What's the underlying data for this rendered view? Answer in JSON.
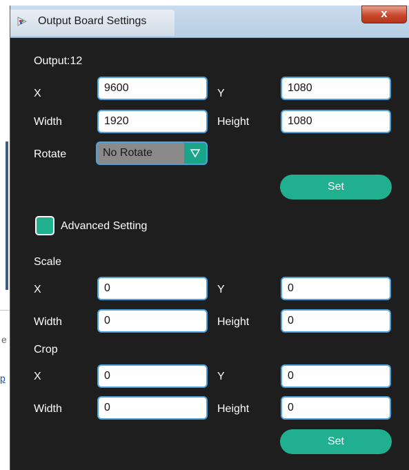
{
  "window": {
    "title": "Output Board Settings",
    "close_label": "x"
  },
  "background": {
    "glyph_e": "e",
    "glyph_p": "p"
  },
  "output_label": "Output:12",
  "position": {
    "x_label": "X",
    "x_value": "9600",
    "y_label": "Y",
    "y_value": "1080",
    "width_label": "Width",
    "width_value": "1920",
    "height_label": "Height",
    "height_value": "1080"
  },
  "rotate": {
    "label": "Rotate",
    "value": "No Rotate"
  },
  "set_label": "Set",
  "advanced": {
    "label": "Advanced Setting",
    "checked": true
  },
  "scale": {
    "title": "Scale",
    "x_label": "X",
    "x_value": "0",
    "y_label": "Y",
    "y_value": "0",
    "width_label": "Width",
    "width_value": "0",
    "height_label": "Height",
    "height_value": "0"
  },
  "crop": {
    "title": "Crop",
    "x_label": "X",
    "x_value": "0",
    "y_label": "Y",
    "y_value": "0",
    "width_label": "Width",
    "width_value": "0",
    "height_label": "Height",
    "height_value": "0"
  },
  "colors": {
    "accent": "#20b08f",
    "field_border": "#4aa3df",
    "panel_bg": "#1e1e1e"
  }
}
